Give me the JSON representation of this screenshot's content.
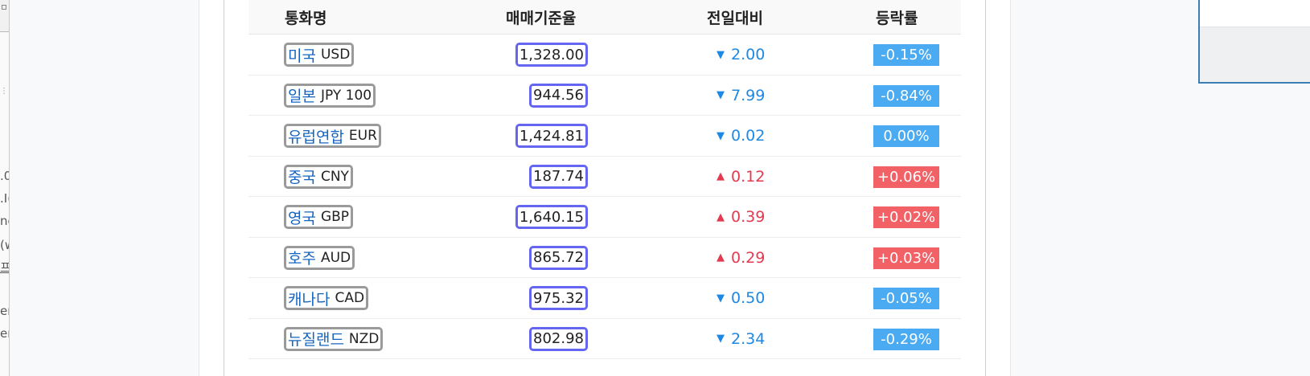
{
  "left_fragments": [
    ".0",
    ".I(",
    "ne",
    "(w",
    "프",
    "er",
    "er"
  ],
  "header": {
    "name": "통화명",
    "rate": "매매기준율",
    "diff": "전일대비",
    "pct": "등락률"
  },
  "rows": [
    {
      "kr": "미국",
      "code": "USD",
      "rate": "1,328.00",
      "dir": "down",
      "arrow": "▼",
      "diff": "2.00",
      "pct": "-0.15%"
    },
    {
      "kr": "일본",
      "code": "JPY 100",
      "rate": "944.56",
      "dir": "down",
      "arrow": "▼",
      "diff": "7.99",
      "pct": "-0.84%"
    },
    {
      "kr": "유럽연합",
      "code": "EUR",
      "rate": "1,424.81",
      "dir": "down",
      "arrow": "▼",
      "diff": "0.02",
      "pct": "0.00%"
    },
    {
      "kr": "중국",
      "code": "CNY",
      "rate": "187.74",
      "dir": "up",
      "arrow": "▲",
      "diff": "0.12",
      "pct": "+0.06%"
    },
    {
      "kr": "영국",
      "code": "GBP",
      "rate": "1,640.15",
      "dir": "up",
      "arrow": "▲",
      "diff": "0.39",
      "pct": "+0.02%"
    },
    {
      "kr": "호주",
      "code": "AUD",
      "rate": "865.72",
      "dir": "up",
      "arrow": "▲",
      "diff": "0.29",
      "pct": "+0.03%"
    },
    {
      "kr": "캐나다",
      "code": "CAD",
      "rate": "975.32",
      "dir": "down",
      "arrow": "▼",
      "diff": "0.50",
      "pct": "-0.05%"
    },
    {
      "kr": "뉴질랜드",
      "code": "NZD",
      "rate": "802.98",
      "dir": "down",
      "arrow": "▼",
      "diff": "2.34",
      "pct": "-0.29%"
    }
  ],
  "colors": {
    "down": "#1e88e5",
    "up": "#e53950",
    "badge_down": "#4aabf2",
    "badge_up": "#f26166",
    "rate_outline": "#6466f1",
    "name_outline": "#9a9a9a"
  }
}
